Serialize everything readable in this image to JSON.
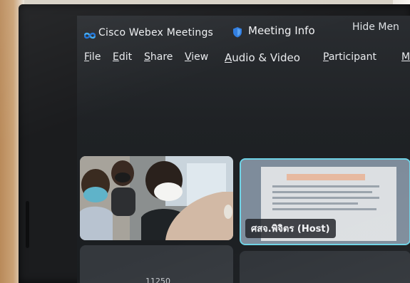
{
  "app": {
    "title": "Cisco Webex Meetings",
    "meeting_info_label": "Meeting Info",
    "hide_menu_label": "Hide Men",
    "icons": [
      "webex-logo-icon",
      "shield-icon"
    ]
  },
  "menubar": {
    "items": [
      {
        "underlined": "F",
        "rest": "ile"
      },
      {
        "underlined": "E",
        "rest": "dit"
      },
      {
        "underlined": "S",
        "rest": "hare"
      },
      {
        "underlined": "V",
        "rest": "iew"
      },
      {
        "underlined": "A",
        "rest": "udio & Video"
      },
      {
        "underlined": "P",
        "rest": "articipant"
      },
      {
        "underlined": "M",
        "rest": ""
      }
    ]
  },
  "video_grid": {
    "host_tile": {
      "name": "ศสจ.พิจิตร (Host)"
    },
    "bottom_tile_label": "11250"
  },
  "colors": {
    "screen_bg": "#1f2225",
    "active_speaker_border": "#6fd3e6",
    "text": "#eef0f2"
  }
}
